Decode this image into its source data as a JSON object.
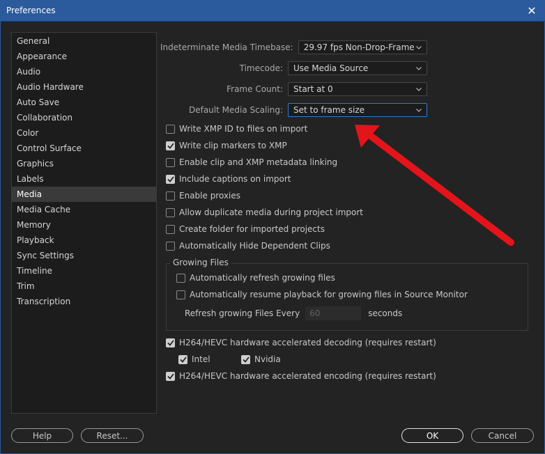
{
  "window": {
    "title": "Preferences",
    "close_glyph": "✕"
  },
  "sidebar": {
    "items": [
      {
        "label": "General"
      },
      {
        "label": "Appearance"
      },
      {
        "label": "Audio"
      },
      {
        "label": "Audio Hardware"
      },
      {
        "label": "Auto Save"
      },
      {
        "label": "Collaboration"
      },
      {
        "label": "Color"
      },
      {
        "label": "Control Surface"
      },
      {
        "label": "Graphics"
      },
      {
        "label": "Labels"
      },
      {
        "label": "Media"
      },
      {
        "label": "Media Cache"
      },
      {
        "label": "Memory"
      },
      {
        "label": "Playback"
      },
      {
        "label": "Sync Settings"
      },
      {
        "label": "Timeline"
      },
      {
        "label": "Trim"
      },
      {
        "label": "Transcription"
      }
    ],
    "selected": "Media"
  },
  "settings": {
    "timebase": {
      "label": "Indeterminate Media Timebase:",
      "value": "29.97 fps Non-Drop-Frame"
    },
    "timecode": {
      "label": "Timecode:",
      "value": "Use Media Source"
    },
    "frame_count": {
      "label": "Frame Count:",
      "value": "Start at 0"
    },
    "scaling": {
      "label": "Default Media Scaling:",
      "value": "Set to frame size"
    }
  },
  "checkboxes": [
    {
      "label": "Write XMP ID to files on import",
      "checked": false
    },
    {
      "label": "Write clip markers to XMP",
      "checked": true
    },
    {
      "label": "Enable clip and XMP metadata linking",
      "checked": false
    },
    {
      "label": "Include captions on import",
      "checked": true
    },
    {
      "label": "Enable proxies",
      "checked": false
    },
    {
      "label": "Allow duplicate media during project import",
      "checked": false
    },
    {
      "label": "Create folder for imported projects",
      "checked": false
    },
    {
      "label": "Automatically Hide Dependent Clips",
      "checked": false
    }
  ],
  "growing_files": {
    "title": "Growing Files",
    "auto_refresh": {
      "label": "Automatically refresh growing files",
      "checked": false
    },
    "auto_resume": {
      "label": "Automatically resume playback for growing files in Source Monitor",
      "checked": false
    },
    "refresh_label": "Refresh growing Files Every",
    "refresh_value": "60",
    "refresh_unit": "seconds"
  },
  "hardware": {
    "decoding": {
      "label": "H264/HEVC hardware accelerated decoding (requires restart)",
      "checked": true
    },
    "intel": {
      "label": "Intel",
      "checked": true
    },
    "nvidia": {
      "label": "Nvidia",
      "checked": true
    },
    "encoding": {
      "label": "H264/HEVC hardware accelerated encoding (requires restart)",
      "checked": true
    }
  },
  "buttons": {
    "help": "Help",
    "reset": "Reset...",
    "ok": "OK",
    "cancel": "Cancel"
  },
  "colors": {
    "titlebar": "#2b5b9c",
    "annotation_arrow": "#e4141b",
    "focus": "#2f7bd6"
  }
}
